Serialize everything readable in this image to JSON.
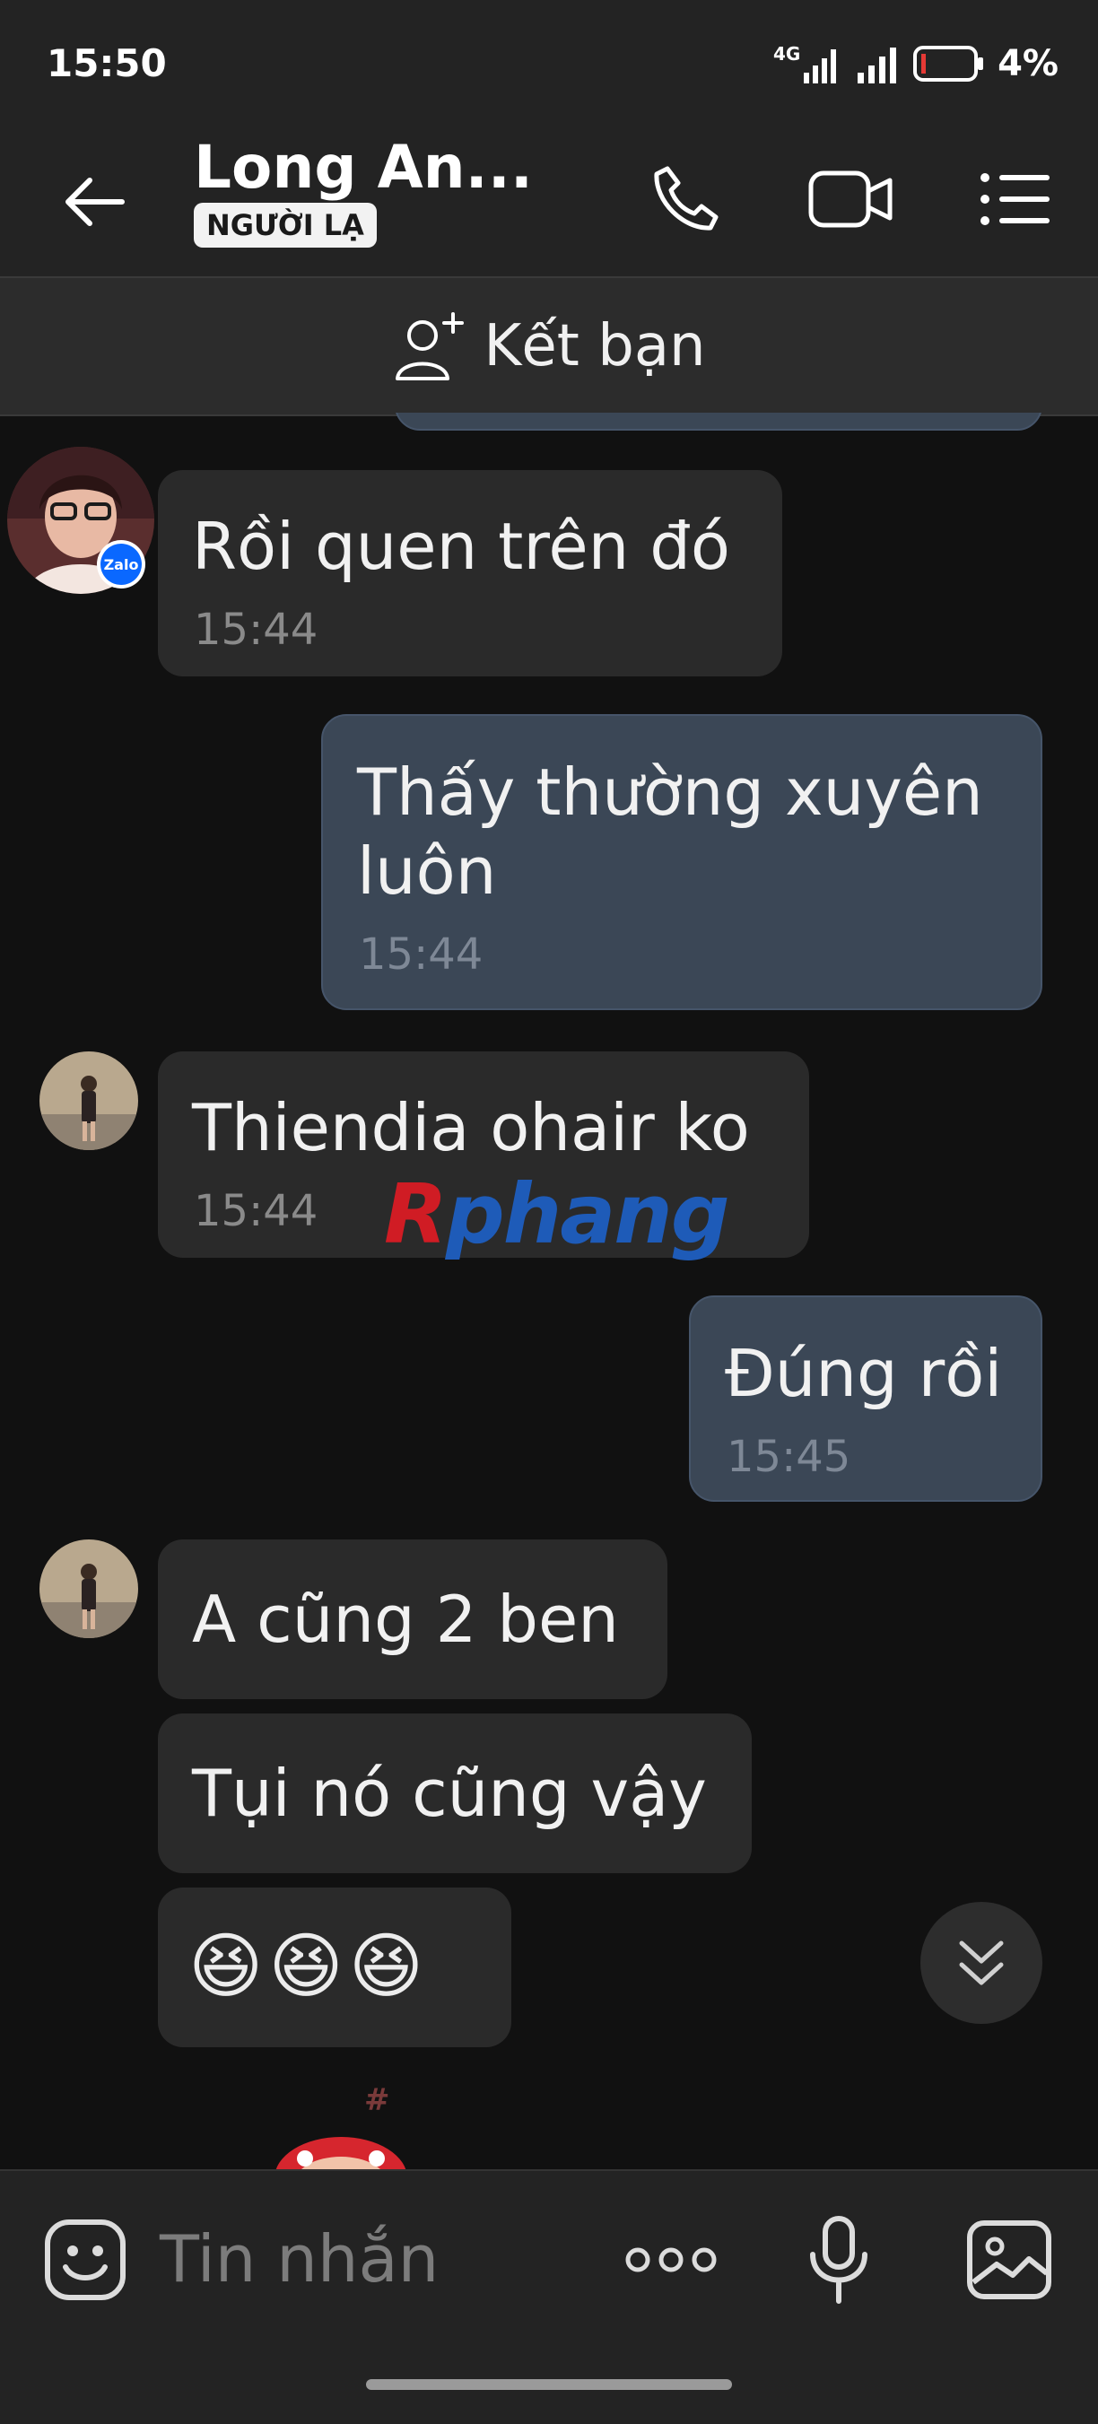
{
  "status": {
    "time": "15:50",
    "network": "4G",
    "battery": "4%"
  },
  "header": {
    "title": "Long An...",
    "badge": "NGƯỜI LẠ"
  },
  "friend_bar": {
    "label": "Kết bạn"
  },
  "messages": [
    {
      "text": "Rồi quen trên đó",
      "time": "15:44"
    },
    {
      "text_line1": "Thấy thường xuyên",
      "text_line2": "luôn",
      "time": "15:44"
    },
    {
      "text": "Thiendia ohair ko",
      "time": "15:44"
    },
    {
      "text": "Đúng rồi",
      "time": "15:45"
    },
    {
      "text": "A cũng 2 ben"
    },
    {
      "text": "Tụi nó cũng vậy"
    },
    {
      "text": "😆😆😆"
    }
  ],
  "avatar_badge": "Zalo",
  "watermark": {
    "first": "R",
    "rest": "phang"
  },
  "input": {
    "placeholder": "Tin nhắn",
    "more": "ooo"
  },
  "icons": [
    "back-arrow-icon",
    "phone-icon",
    "video-call-icon",
    "menu-list-icon",
    "add-friend-icon",
    "scroll-down-icon",
    "emoji-icon",
    "more-options-icon",
    "microphone-icon",
    "image-icon"
  ],
  "colors": {
    "background": "#111111",
    "incoming_bubble": "#2a2a2a",
    "outgoing_bubble": "#3b4756",
    "header": "#232323"
  }
}
